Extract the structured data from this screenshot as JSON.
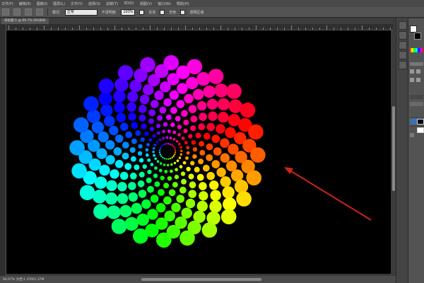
{
  "menu": [
    "文件(F)",
    "编辑(E)",
    "图像(I)",
    "图层(L)",
    "文字(Y)",
    "选择(S)",
    "滤镜(T)",
    "3D(D)",
    "视图(V)",
    "窗口(W)",
    "帮助(H)"
  ],
  "options": {
    "mode_label": "模式:",
    "mode_value": "正常",
    "opacity_label": "不透明度:",
    "opacity_value": "100%",
    "reverse_label": "反向",
    "dither_label": "仿色",
    "transparency_label": "透明区域"
  },
  "document_tab": "未标题-1 @ 66.7% (RGB/8)",
  "status_text": "66.67%   文档:1.37M/1.37M",
  "colors": {
    "canvas": "#000000",
    "arrow": "#d0231e"
  },
  "artwork": {
    "type": "spiral dot pattern",
    "spiral_arms": 24,
    "dots_per_arm": 12,
    "hue_cycle": "rainbow"
  },
  "icons": [
    "move-tool-icon",
    "marquee-tool-icon",
    "lasso-tool-icon",
    "gradient-tool-icon"
  ]
}
